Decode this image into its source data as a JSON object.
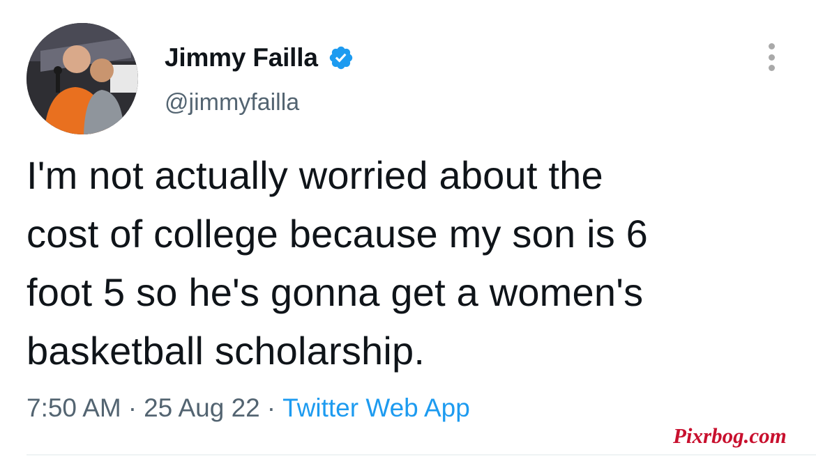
{
  "author": {
    "display_name": "Jimmy Failla",
    "handle": "@jimmyfailla",
    "verified_icon": "verified-badge-icon",
    "avatar_icon": "profile-avatar"
  },
  "tweet": {
    "lines": [
      "I'm not actually worried about the",
      "cost of college because my son is 6",
      "foot 5 so he's gonna get a women's",
      "basketball scholarship."
    ]
  },
  "meta": {
    "time": "7:50 AM",
    "date": "25 Aug 22",
    "separator": "·",
    "source": "Twitter Web App"
  },
  "more_icon": "more-options-icon",
  "watermark": "Pixrbog.com",
  "colors": {
    "text": "#0f1419",
    "secondary": "#536471",
    "accent": "#1d9bf0",
    "watermark": "#c8102e"
  }
}
